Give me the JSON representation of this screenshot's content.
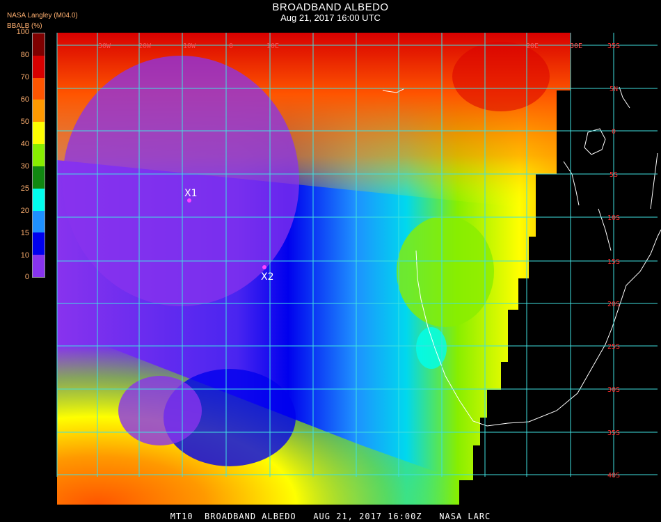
{
  "header": {
    "title": "BROADBAND ALBEDO",
    "subtitle": "Aug 21, 2017 16:00 UTC",
    "source": "NASA Langley (M04.0)",
    "unit_label": "BBALB (%)"
  },
  "legend": {
    "ticks": [
      "100",
      "80",
      "70",
      "60",
      "50",
      "40",
      "30",
      "25",
      "20",
      "15",
      "10",
      "0"
    ],
    "colors": [
      "#7f0000",
      "#d80000",
      "#ff5500",
      "#ff9900",
      "#ffff00",
      "#88ee00",
      "#118811",
      "#00ffee",
      "#1e90ff",
      "#0000ee",
      "#8833ee"
    ]
  },
  "map": {
    "lat_labels": [
      "35S",
      "5N",
      "0",
      "5S",
      "10S",
      "15S",
      "20S",
      "25S",
      "30S",
      "35S",
      "40S"
    ],
    "lon_labels": [
      "30W",
      "20W",
      "10W",
      "0",
      "10E",
      "20E",
      "30E"
    ],
    "markers": [
      {
        "label": "X1",
        "color": "#ff44ff"
      },
      {
        "label": "X2",
        "color": "#ff44ff"
      }
    ],
    "grid_color": "#40e0e0"
  },
  "footer": {
    "text": "MT10  BROADBAND ALBEDO   AUG 21, 2017 16:00Z   NASA LARC"
  }
}
